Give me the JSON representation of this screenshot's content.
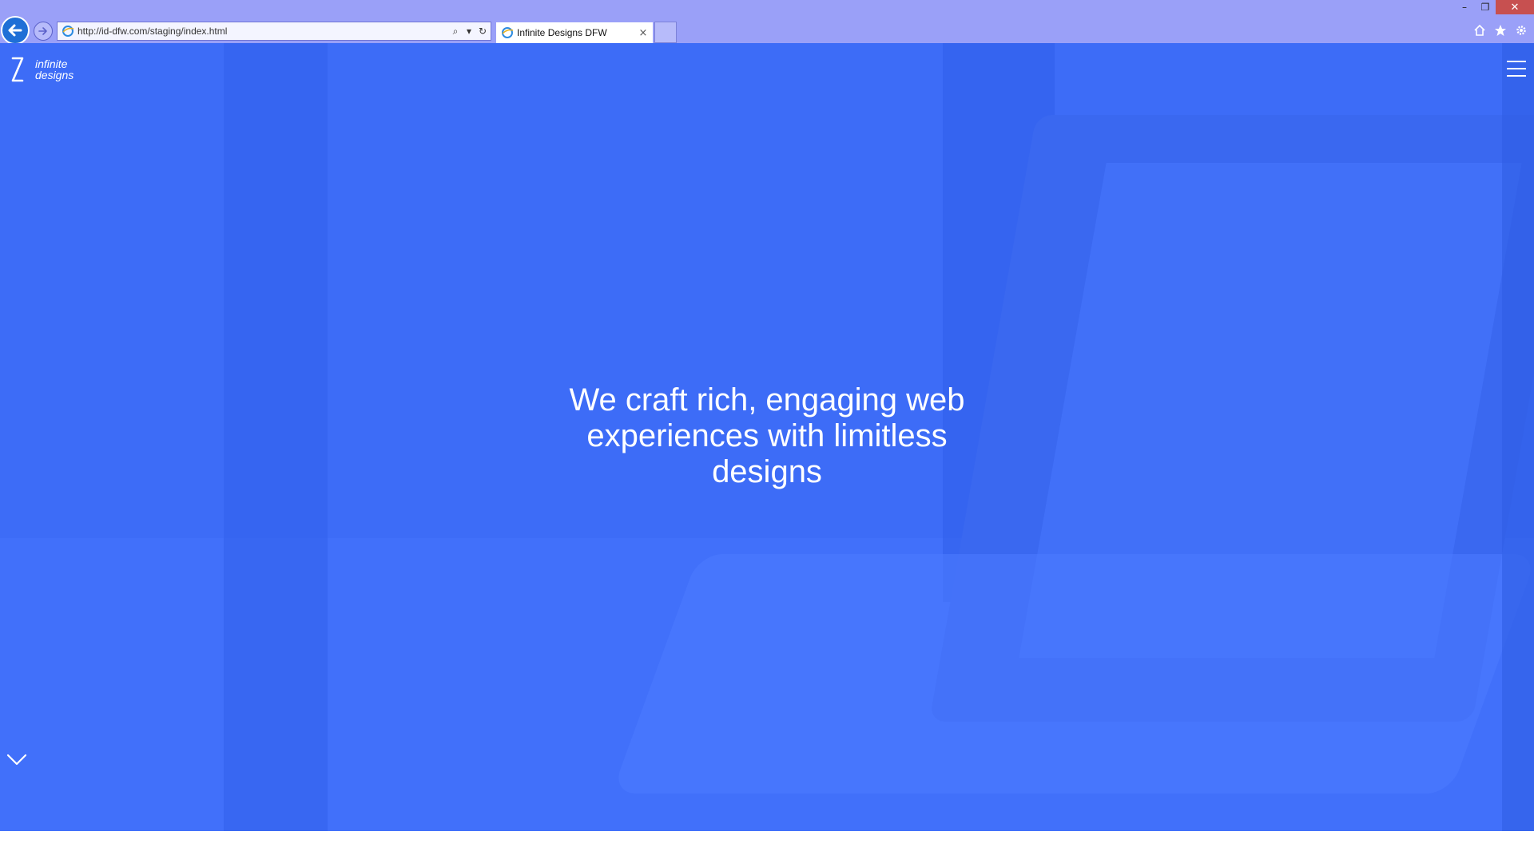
{
  "browser": {
    "address": "http://id-dfw.com/staging/index.html",
    "tab_title": "Infinite Designs DFW",
    "tab_close": "×",
    "window": {
      "minimize": "–",
      "restore": "❐",
      "close": "✕"
    },
    "address_icons": {
      "search": "⌕",
      "dropdown": "▾",
      "refresh": "↻"
    }
  },
  "page": {
    "brand_text": "infinite\ndesigns",
    "headline": "We craft rich, engaging web experiences with limitless designs",
    "colors": {
      "hero": "#3d6cf7",
      "chrome": "#9aa0f8",
      "back_button": "#1f6fd6",
      "close_button": "#c75050"
    }
  }
}
